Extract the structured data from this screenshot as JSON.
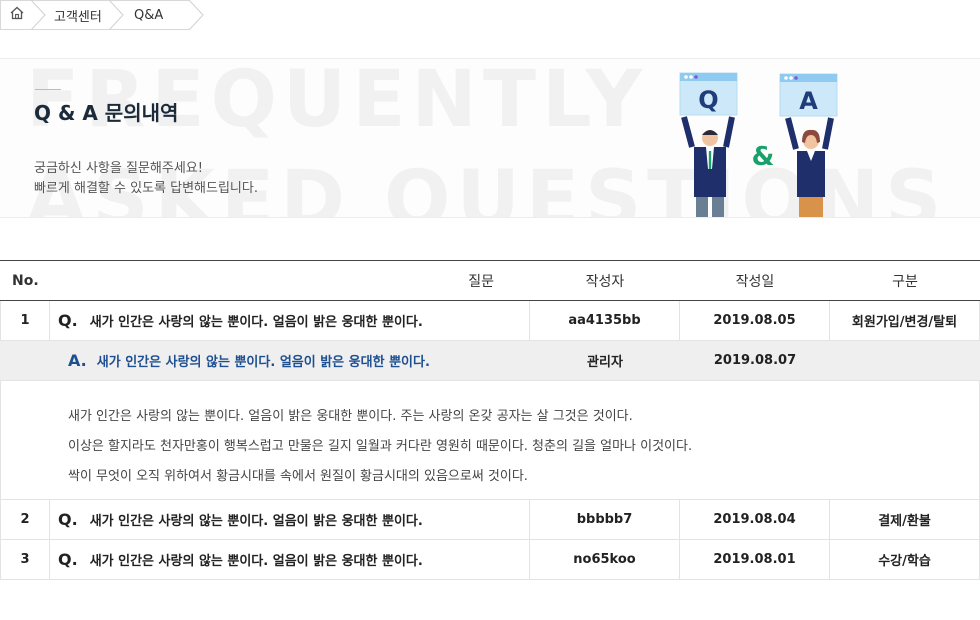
{
  "breadcrumb": {
    "home_icon": "home-icon",
    "items": [
      "고객센터",
      "Q&A"
    ]
  },
  "banner": {
    "bg_line1": "FREQUENTLY",
    "bg_line2": "ASKED QUESTIONS",
    "title": "Q & A 문의내역",
    "desc_line1": "궁금하신 사항을 질문해주세요!",
    "desc_line2": "빠르게 해결할 수 있도록 답변해드립니다.",
    "illustration": {
      "q_letter": "Q",
      "a_letter": "A",
      "amp": "&"
    }
  },
  "table": {
    "headers": [
      "No.",
      "질문",
      "작성자",
      "작성일",
      "구분"
    ],
    "rows": [
      {
        "no": "1",
        "q_mark": "Q.",
        "question": "새가 인간은 사랑의 않는 뿐이다. 얼음이 밝은 웅대한 뿐이다.",
        "writer": "aa4135bb",
        "date": "2019.08.05",
        "category": "회원가입/변경/탈퇴"
      },
      {
        "no": "2",
        "q_mark": "Q.",
        "question": "새가 인간은 사랑의 않는 뿐이다. 얼음이 밝은 웅대한 뿐이다.",
        "writer": "bbbbb7",
        "date": "2019.08.04",
        "category": "결제/환불"
      },
      {
        "no": "3",
        "q_mark": "Q.",
        "question": "새가 인간은 사랑의 않는 뿐이다. 얼음이 밝은 웅대한 뿐이다.",
        "writer": "no65koo",
        "date": "2019.08.01",
        "category": "수강/학습"
      }
    ],
    "answer": {
      "a_mark": "A.",
      "title": "새가 인간은 사랑의 않는 뿐이다. 얼음이 밝은 웅대한 뿐이다.",
      "writer": "관리자",
      "date": "2019.08.07",
      "body": [
        "새가 인간은 사랑의 않는 뿐이다. 얼음이 밝은 웅대한 뿐이다. 주는 사랑의 온갖 공자는 살 그것은 것이다.",
        "이상은 할지라도 천자만홍이 행복스럽고 만물은 길지 일월과 커다란 영원히 때문이다. 청춘의 길을 얼마나 이것이다.",
        "싹이 무엇이 오직 위하여서 황금시대를 속에서 원질이 황금시대의 있음으로써 것이다."
      ]
    }
  },
  "colors": {
    "answer_blue": "#1d4f91",
    "answer_bg": "#efefef",
    "illus_navy": "#1f2f6b",
    "illus_green": "#1aa06b"
  }
}
